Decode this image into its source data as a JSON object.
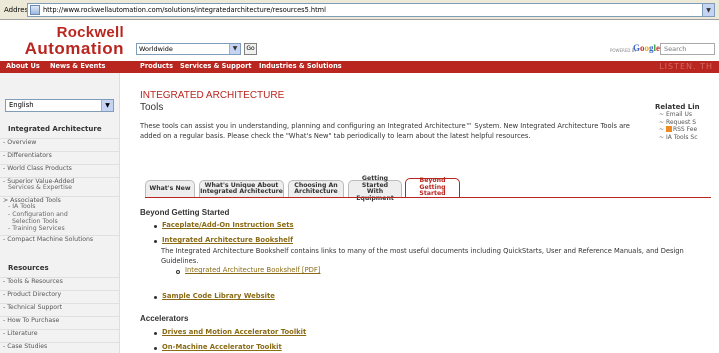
{
  "browser": {
    "address_label": "Address",
    "url": "http://www.rockwellautomation.com/solutions/integratedarchitecture/resources5.html"
  },
  "header": {
    "logo_line1": "Rockwell",
    "logo_line2": "Automation",
    "region_select": "Worldwide",
    "go_label": "Go",
    "powered_by": "POWERED BY",
    "google": [
      "G",
      "o",
      "o",
      "g",
      "l",
      "e"
    ],
    "search_placeholder": "Search"
  },
  "nav": {
    "items": [
      "About Us",
      "News & Events",
      "Products",
      "Services & Support",
      "Industries & Solutions"
    ],
    "tagline": "LISTEN. TH"
  },
  "sidebar": {
    "language": "English",
    "section1_title": "Integrated Architecture",
    "section1_items": [
      "Overview",
      "Differentiators",
      "World Class Products",
      "Superior Value-Added",
      "Services & Expertise",
      "Associated Tools",
      "IA Tools",
      "Configuration and",
      "Selection Tools",
      "Training Services",
      "Compact Machine Solutions"
    ],
    "section2_title": "Resources",
    "section2_items": [
      "Tools & Resources",
      "Product Directory",
      "Technical Support",
      "How To Purchase",
      "Literature",
      "Case Studies"
    ]
  },
  "main": {
    "title": "INTEGRATED ARCHITECTURE",
    "subtitle": "Tools",
    "intro": "These tools can assist you in understanding, planning and configuring an Integrated Architecture™ System. New Integrated Architecture Tools are added on a regular basis. Please check the \"What's New\" tab periodically to learn about the latest helpful resources.",
    "related_title": "Related Lin",
    "related_items": [
      "Email Us",
      "Request S",
      "RSS Fee",
      "IA Tools Sc"
    ],
    "tabs": [
      {
        "line1": "What's New",
        "line2": ""
      },
      {
        "line1": "What's Unique About",
        "line2": "Integrated Architecture"
      },
      {
        "line1": "Choosing An",
        "line2": "Architecture"
      },
      {
        "line1": "Getting Started",
        "line2": "With Equipment"
      },
      {
        "line1": "Beyond",
        "line2": "Getting Started"
      }
    ],
    "section_beyond": "Beyond Getting Started",
    "link_faceplate": "Faceplate/Add-On Instruction Sets",
    "link_bookshelf": "Integrated Architecture Bookshelf",
    "bookshelf_desc": "The Integrated Architecture Bookshelf contains links to many of the most useful documents including QuickStarts, User and Reference Manuals, and Design Guidelines.",
    "link_bookshelf_pdf": "Integrated Architecture Bookshelf [PDF]",
    "link_sample_code": "Sample Code Library Website",
    "section_accelerators": "Accelerators",
    "link_drives": "Drives and Motion Accelerator Toolkit",
    "link_onmachine": "On-Machine Accelerator Toolkit"
  }
}
